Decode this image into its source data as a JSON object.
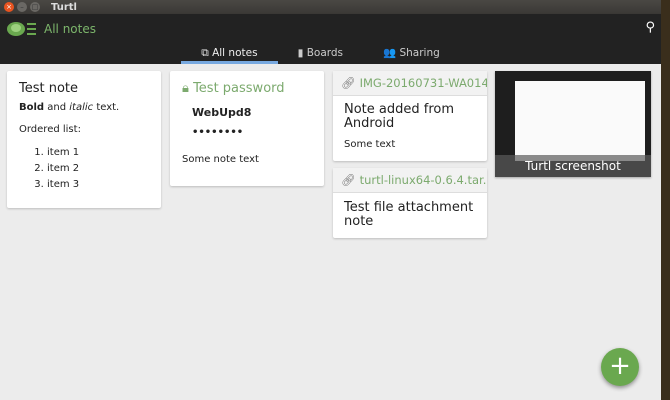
{
  "window": {
    "title": "Turtl"
  },
  "header": {
    "title": "All notes"
  },
  "tabs": [
    {
      "label": "All notes",
      "icon": "notes-icon"
    },
    {
      "label": "Boards",
      "icon": "boards-icon"
    },
    {
      "label": "Sharing",
      "icon": "sharing-icon"
    }
  ],
  "notes": [
    {
      "title": "Test note",
      "bold": "Bold",
      "and": " and ",
      "italic": "italic",
      "rest": " text.",
      "list_label": "Ordered list:",
      "items": [
        "item 1",
        "item 2",
        "item 3"
      ]
    },
    {
      "title": "Test password",
      "username": "WebUpd8",
      "password": "••••••••",
      "text": "Some note text"
    },
    {
      "attachment": "IMG-20160731-WA014...",
      "title": "Note added from Android",
      "text": "Some text"
    },
    {
      "attachment": "turtl-linux64-0.6.4.tar.b...",
      "title": "Test file attachment note"
    },
    {
      "caption": "Turtl screenshot"
    }
  ],
  "fab": {
    "label": "+"
  }
}
